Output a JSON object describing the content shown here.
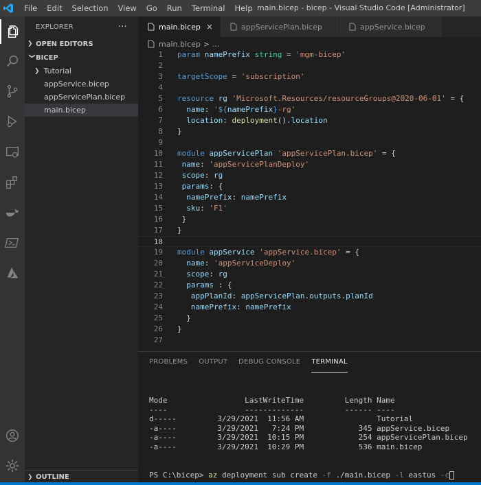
{
  "titlebar": {
    "menu": [
      "File",
      "Edit",
      "Selection",
      "View",
      "Go",
      "Run",
      "Terminal",
      "Help"
    ],
    "window_title": "main.bicep - bicep - Visual Studio Code [Administrator]"
  },
  "sidebar": {
    "title": "EXPLORER",
    "more": "···",
    "open_editors": "OPEN EDITORS",
    "folder": "BICEP",
    "items": [
      {
        "label": "Tutorial",
        "type": "folder"
      },
      {
        "label": "appService.bicep",
        "type": "file"
      },
      {
        "label": "appServicePlan.bicep",
        "type": "file"
      },
      {
        "label": "main.bicep",
        "type": "file"
      }
    ],
    "outline": "OUTLINE"
  },
  "tabs": [
    {
      "label": "main.bicep",
      "active": true,
      "close": "×"
    },
    {
      "label": "appServicePlan.bicep",
      "active": false
    },
    {
      "label": "appService.bicep",
      "active": false
    }
  ],
  "breadcrumb": {
    "file": "main.bicep",
    "sep": ">",
    "rest": "..."
  },
  "code": [
    "param namePrefix string = 'mgm-bicep'",
    "",
    "targetScope = 'subscription'",
    "",
    "resource rg 'Microsoft.Resources/resourceGroups@2020-06-01' = {",
    "  name: '${namePrefix}-rg'",
    "  location: deployment().location",
    "}",
    "",
    "module appServicePlan 'appServicePlan.bicep' = {",
    " name: 'appServicePlanDeploy'",
    " scope: rg",
    " params: {",
    "  namePrefix: namePrefix",
    "  sku: 'F1'",
    " }",
    "}",
    "",
    "module appService 'appService.bicep' = {",
    "  name: 'appServiceDeploy'",
    "  scope: rg",
    "  params : {",
    "   appPlanId: appServicePlan.outputs.planId",
    "   namePrefix: namePrefix",
    "  }",
    "}",
    ""
  ],
  "current_line": 18,
  "panel": {
    "tabs": [
      "PROBLEMS",
      "OUTPUT",
      "DEBUG CONSOLE",
      "TERMINAL"
    ],
    "active_tab": "TERMINAL",
    "terminal_lines": [
      "Mode                 LastWriteTime         Length Name",
      "----                 -------------         ------ ----",
      "d-----         3/29/2021  11:56 AM                Tutorial",
      "-a----         3/29/2021   7:24 PM            345 appService.bicep",
      "-a----         3/29/2021  10:15 PM            254 appServicePlan.bicep",
      "-a----         3/29/2021  10:29 PM            536 main.bicep"
    ],
    "prompt": "PS C:\\bicep> ",
    "command": "az",
    "command_rest": " deployment sub create ",
    "flag1": "-f",
    "arg1": " ./main.bicep ",
    "flag2": "-l",
    "arg2": " eastus ",
    "flag3": "-c"
  },
  "colors": {
    "accent": "#007acc",
    "keyword": "#569cd6",
    "string": "#ce9178",
    "identifier": "#9cdcfe",
    "function": "#dcdcaa"
  }
}
